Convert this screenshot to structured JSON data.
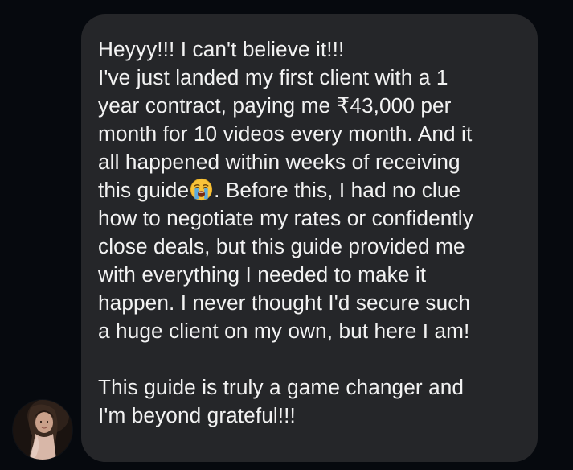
{
  "message": {
    "paragraph_1_lines": [
      "Heyyy!!! I can't believe it!!!",
      "I've just landed my first client with a 1",
      "year contract, paying me ₹43,000 per",
      "month for 10 videos every month. And it",
      "all happened within weeks of receiving",
      "this guide",
      ". Before this, I had no clue",
      "how to negotiate my rates or confidently",
      "close deals, but this guide provided me",
      "with everything I needed to make it",
      "happen. I never thought I'd secure such",
      "a huge client on my own, but here I am!"
    ],
    "paragraph_2_lines": [
      "This guide is truly a game changer and",
      "I'm beyond grateful!!!"
    ],
    "inline_emoji": "loudly-crying-face-icon"
  },
  "colors": {
    "background": "#06090e",
    "bubble": "#252629",
    "text": "#f2f2f2"
  }
}
